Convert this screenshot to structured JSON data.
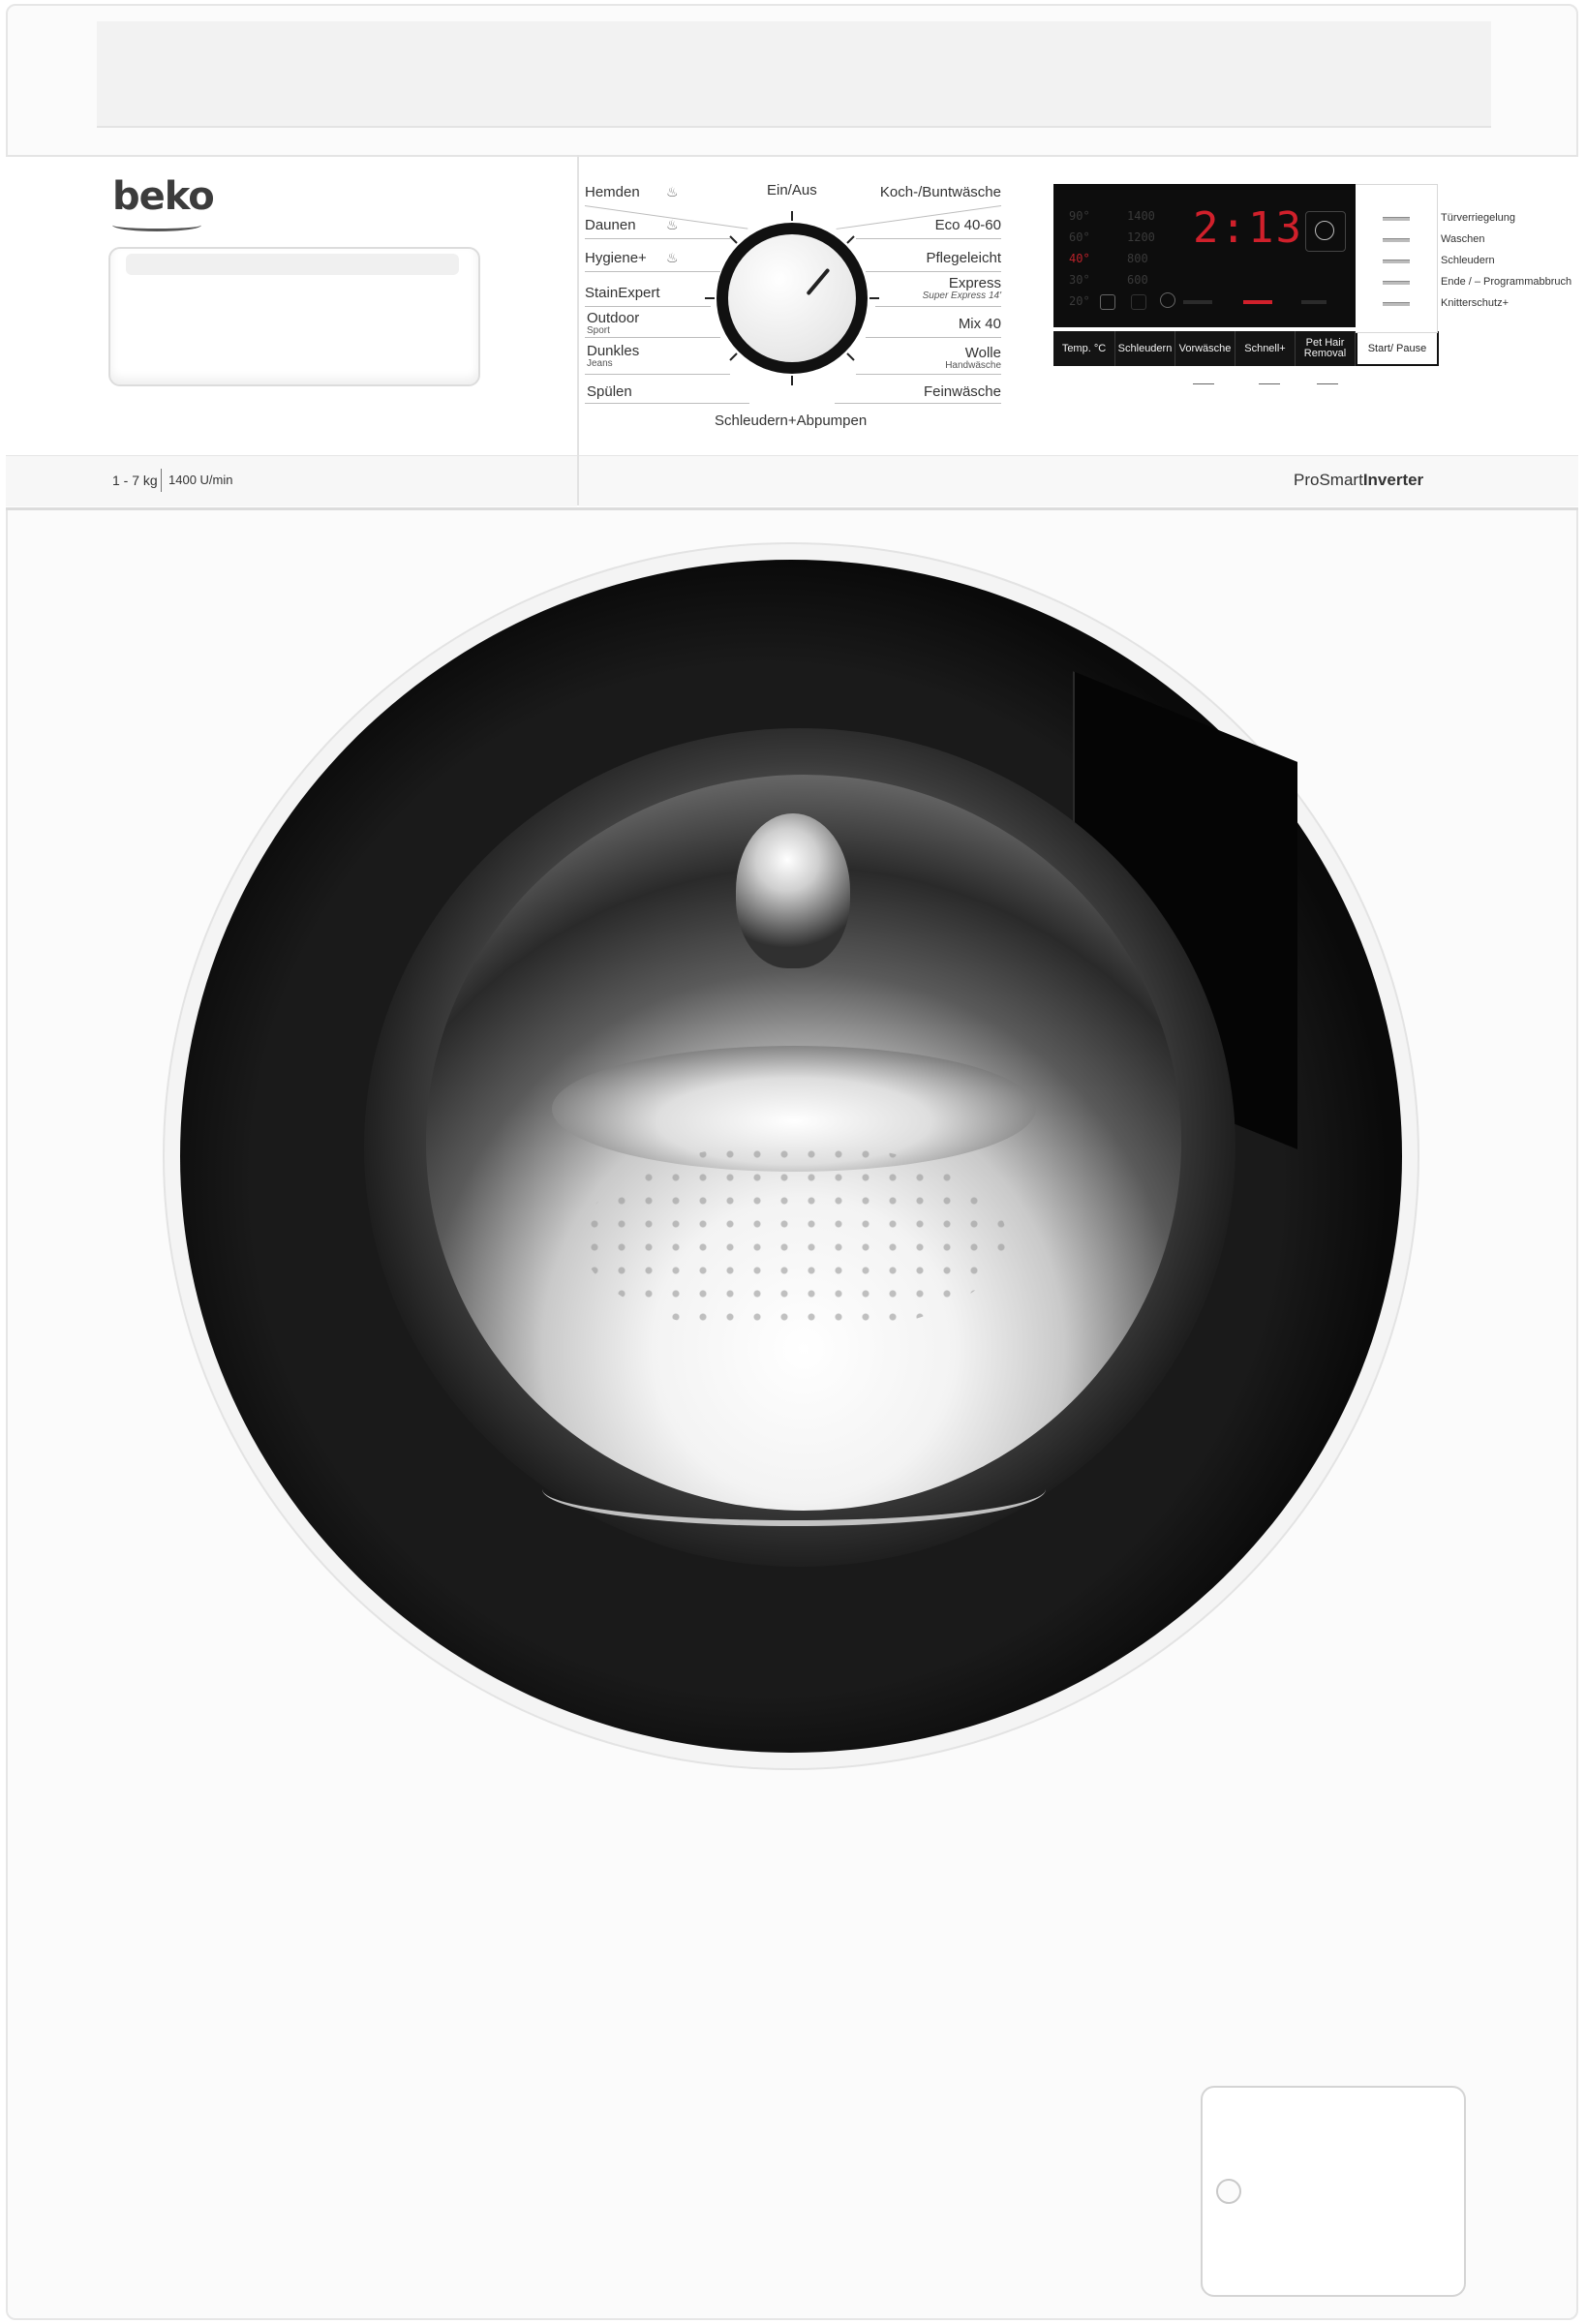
{
  "brand": {
    "logo": "beko",
    "capacity": "1 - 7 kg",
    "spin_speed": "1400 U/min",
    "series_prefix": "Pro",
    "series_main": "Smart",
    "series_bold": "Inverter"
  },
  "dial": {
    "top": "Ein/Aus",
    "bottom": "Schleudern+Abpumpen",
    "left": [
      {
        "label": "Hemden",
        "sub": ""
      },
      {
        "label": "Daunen",
        "sub": ""
      },
      {
        "label": "Hygiene+",
        "sub": ""
      },
      {
        "label": "StainExpert",
        "sub": ""
      },
      {
        "label": "Outdoor",
        "sub": "Sport"
      },
      {
        "label": "Dunkles",
        "sub": "Jeans"
      },
      {
        "label": "Spülen",
        "sub": ""
      }
    ],
    "right": [
      {
        "label": "Koch-/Buntwäsche",
        "sub": ""
      },
      {
        "label": "Eco 40-60",
        "sub": ""
      },
      {
        "label": "Pflegeleicht",
        "sub": ""
      },
      {
        "label": "Express",
        "sub": "Super Express 14'"
      },
      {
        "label": "Mix 40",
        "sub": ""
      },
      {
        "label": "Wolle",
        "sub": "Handwäsche"
      },
      {
        "label": "Feinwäsche",
        "sub": ""
      }
    ]
  },
  "display": {
    "time": "2:13",
    "temperatures": [
      "90°",
      "60°",
      "40°",
      "30°",
      "20°"
    ],
    "active_temperature_index": 2,
    "spins": [
      "1400",
      "1200",
      "800",
      "600"
    ],
    "accent_color": "#d0202b"
  },
  "buttons": [
    "Temp. °C",
    "Schleudern",
    "Vorwäsche",
    "Schnell+",
    "Pet Hair Removal"
  ],
  "start_button": "Start/ Pause",
  "indicators": [
    "Türverriegelung",
    "Waschen",
    "Schleudern",
    "Ende / – Programmabbruch",
    "Knitterschutz+"
  ],
  "icons": {
    "timer": "clock-icon",
    "under_buttons": [
      "3s-icon",
      "child-lock-3s-icon",
      "remote-3s-icon"
    ]
  }
}
